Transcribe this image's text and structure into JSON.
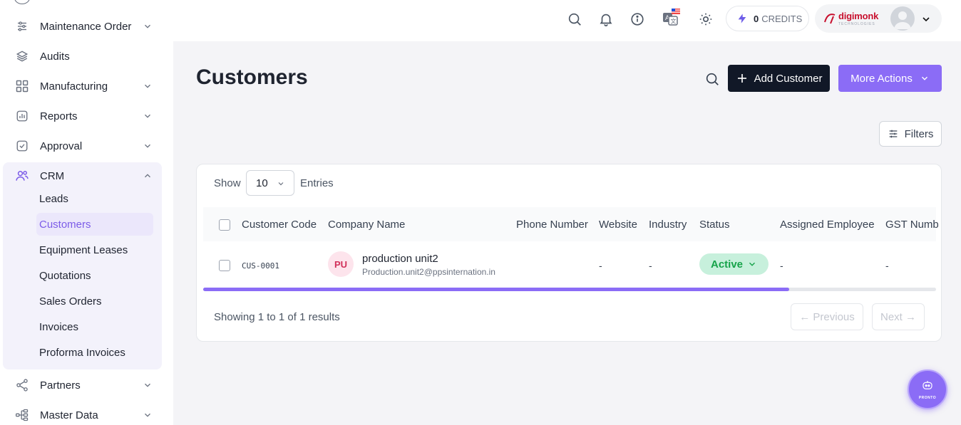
{
  "sidebar": {
    "items": [
      {
        "label": "Maintenance Order",
        "icon": "sliders-icon",
        "expandable": true
      },
      {
        "label": "Audits",
        "icon": "layers-icon",
        "expandable": false
      },
      {
        "label": "Manufacturing",
        "icon": "grid-icon",
        "expandable": true
      },
      {
        "label": "Reports",
        "icon": "chart-icon",
        "expandable": true
      },
      {
        "label": "Approval",
        "icon": "check-square-icon",
        "expandable": true
      },
      {
        "label": "CRM",
        "icon": "users-icon",
        "expandable": true,
        "expanded": true
      },
      {
        "label": "Partners",
        "icon": "share-icon",
        "expandable": true
      },
      {
        "label": "Master Data",
        "icon": "tree-icon",
        "expandable": true
      }
    ],
    "crm_subitems": [
      "Leads",
      "Customers",
      "Equipment Leases",
      "Quotations",
      "Sales Orders",
      "Invoices",
      "Proforma Invoices"
    ],
    "active_subitem": "Customers"
  },
  "topbar": {
    "credits_count": "0",
    "credits_label": "CREDITS",
    "brand_name": "digimonk",
    "brand_sub": "TECHNOLOGIES"
  },
  "main": {
    "title": "Customers",
    "add_button": "Add Customer",
    "more_button": "More Actions",
    "filters_button": "Filters",
    "show_label": "Show",
    "entries_value": "10",
    "entries_label": "Entries",
    "columns": [
      "Customer Code",
      "Company Name",
      "Phone Number",
      "Website",
      "Industry",
      "Status",
      "Assigned Employee",
      "GST Numb"
    ],
    "rows": [
      {
        "code": "CUS-0001",
        "initials": "PU",
        "company": "production unit2",
        "email": "Production.unit2@ppsinternation.in",
        "phone": "",
        "website": "-",
        "industry": "-",
        "status": "Active",
        "employee": "-",
        "gst": "-"
      }
    ],
    "scroll_fraction": 0.8,
    "showing_text": "Showing 1 to 1 of 1 results",
    "prev_label": "← Previous",
    "next_label": "Next →"
  },
  "fab": {
    "label": "PRONTO"
  },
  "colors": {
    "accent": "#8b6cf6",
    "dark_button": "#111827",
    "status_active_bg": "#c7f0dc",
    "status_active_fg": "#16a34a"
  }
}
